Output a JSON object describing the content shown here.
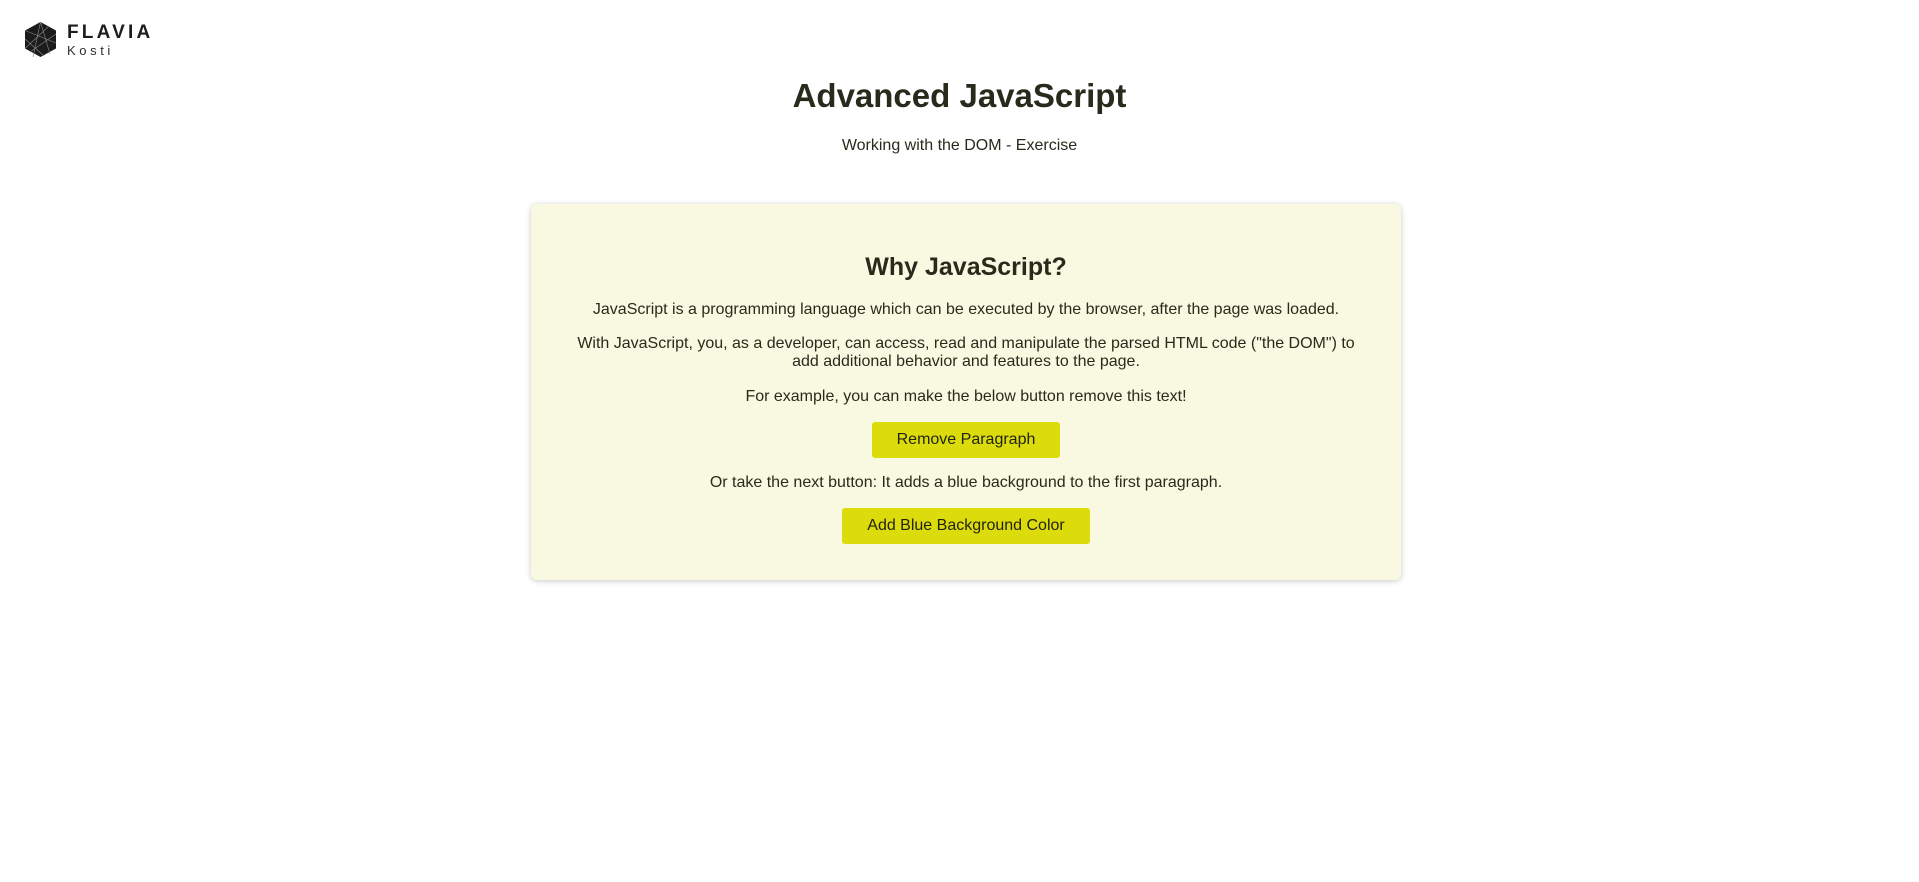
{
  "brand": {
    "name": "FLAVIA",
    "sub": "Kosti",
    "logo_icon": "hexagon-logo-icon"
  },
  "header": {
    "title": "Advanced JavaScript",
    "subtitle": "Working with the DOM - Exercise"
  },
  "card": {
    "title": "Why JavaScript?",
    "paragraph1": "JavaScript is a programming language which can be executed by the browser, after the page was loaded.",
    "paragraph2": "With JavaScript, you, as a developer, can access, read and manipulate the parsed HTML code (\"the DOM\") to add additional behavior and features to the page.",
    "paragraph3": "For example, you can make the below button remove this text!",
    "remove_button": "Remove Paragraph",
    "paragraph4": "Or take the next button: It adds a blue background to the first paragraph.",
    "blue_button": "Add Blue Background Color"
  },
  "colors": {
    "card_background": "#f8f9e0",
    "button_background": "#dcdb0b",
    "text": "#2a2a1c"
  }
}
